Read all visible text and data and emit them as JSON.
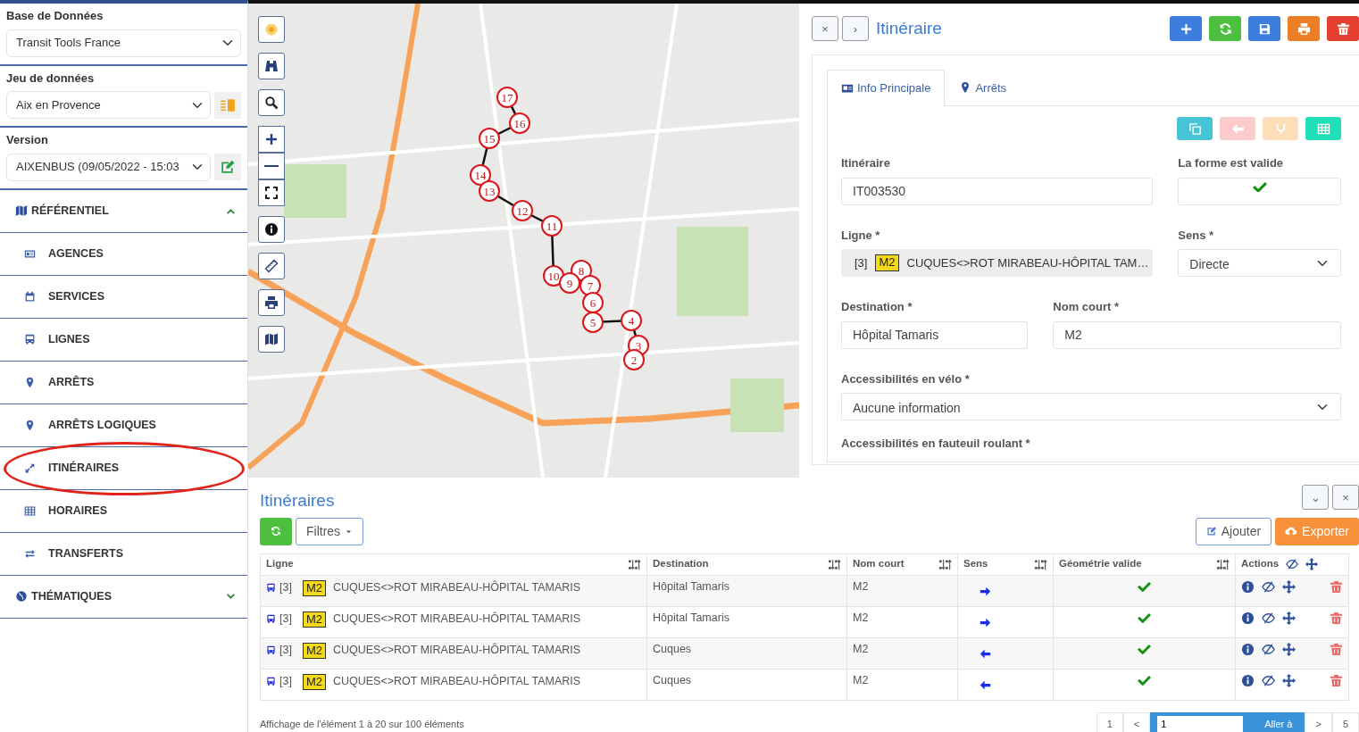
{
  "sidebar": {
    "fields": [
      {
        "label": "Base de Données",
        "value": "Transit Tools France"
      },
      {
        "label": "Jeu de données",
        "value": "Aix en Provence"
      },
      {
        "label": "Version",
        "value": "AIXENBUS (09/05/2022 - 15:03"
      }
    ],
    "sections": [
      {
        "title": "RÉFÉRENTIEL",
        "expanded": true,
        "items": [
          {
            "label": "AGENCES",
            "circled": false
          },
          {
            "label": "SERVICES",
            "circled": false
          },
          {
            "label": "LIGNES",
            "circled": false
          },
          {
            "label": "ARRÊTS",
            "circled": false
          },
          {
            "label": "ARRÊTS LOGIQUES",
            "circled": false
          },
          {
            "label": "ITINÉRAIRES",
            "circled": true
          },
          {
            "label": "HORAIRES",
            "circled": false
          },
          {
            "label": "TRANSFERTS",
            "circled": false
          }
        ]
      },
      {
        "title": "THÉMATIQUES",
        "expanded": false
      }
    ]
  },
  "map": {
    "stops": [
      {
        "label": "17"
      },
      {
        "label": "16"
      },
      {
        "label": "15"
      },
      {
        "label": "14"
      },
      {
        "label": "13"
      },
      {
        "label": "12"
      },
      {
        "label": "11"
      },
      {
        "label": "8"
      },
      {
        "label": "10"
      },
      {
        "label": "9"
      },
      {
        "label": "7"
      },
      {
        "label": "6"
      },
      {
        "label": "4"
      },
      {
        "label": "5"
      },
      {
        "label": "3"
      },
      {
        "label": "2"
      }
    ]
  },
  "detail": {
    "nav_buttons": [
      "×",
      "›"
    ],
    "title": "Itinéraire",
    "tabs": [
      {
        "label": "Info Principale",
        "selected": true
      },
      {
        "label": "Arrêts",
        "selected": false
      }
    ],
    "toolbar": [
      {
        "disabled": false
      },
      {
        "disabled": true
      },
      {
        "disabled": true
      },
      {
        "disabled": false
      }
    ],
    "form": {
      "itineraire": {
        "label": "Itinéraire",
        "value": "IT003530"
      },
      "shape_valid": {
        "label": "La forme est valide",
        "checked": true
      },
      "ligne": {
        "label": "Ligne *",
        "number": "[3]",
        "badge": "M2",
        "name": "CUQUES<>ROT MIRABEAU-HÔPITAL TAM…"
      },
      "sens": {
        "label": "Sens *",
        "value": "Directe"
      },
      "destination": {
        "label": "Destination *",
        "value": "Hôpital Tamaris"
      },
      "nom_court": {
        "label": "Nom court *",
        "value": "M2"
      },
      "velo": {
        "label": "Accessibilités en vélo *",
        "value": "Aucune information"
      },
      "fauteuil": {
        "label": "Accessibilités en fauteuil roulant *"
      }
    }
  },
  "list": {
    "title": "Itinéraires",
    "panel_buttons": [
      "⌄",
      "×"
    ],
    "filter_button": "Filtres",
    "add_button": "Ajouter",
    "export_button": "Exporter",
    "columns": [
      "Ligne",
      "Destination",
      "Nom court",
      "Sens",
      "Géométrie valide",
      "Actions"
    ],
    "rows": [
      {
        "number": "[3]",
        "badge": "M2",
        "line": "CUQUES<>ROT MIRABEAU-HÔPITAL TAMARIS",
        "destination": "Hôpital Tamaris",
        "short_name": "M2",
        "forward": true,
        "geometry_valid": true
      },
      {
        "number": "[3]",
        "badge": "M2",
        "line": "CUQUES<>ROT MIRABEAU-HÔPITAL TAMARIS",
        "destination": "Hôpital Tamaris",
        "short_name": "M2",
        "forward": true,
        "geometry_valid": true
      },
      {
        "number": "[3]",
        "badge": "M2",
        "line": "CUQUES<>ROT MIRABEAU-HÔPITAL TAMARIS",
        "destination": "Cuques",
        "short_name": "M2",
        "forward": false,
        "geometry_valid": true
      },
      {
        "number": "[3]",
        "badge": "M2",
        "line": "CUQUES<>ROT MIRABEAU-HÔPITAL TAMARIS",
        "destination": "Cuques",
        "short_name": "M2",
        "forward": false,
        "geometry_valid": true
      }
    ],
    "summary": "Affichage de l'élément 1 à 20 sur 100 éléments",
    "pagination": {
      "first": "1",
      "prev": "<",
      "page_value": "1",
      "go": "Aller à",
      "next": ">",
      "last": "5"
    }
  }
}
